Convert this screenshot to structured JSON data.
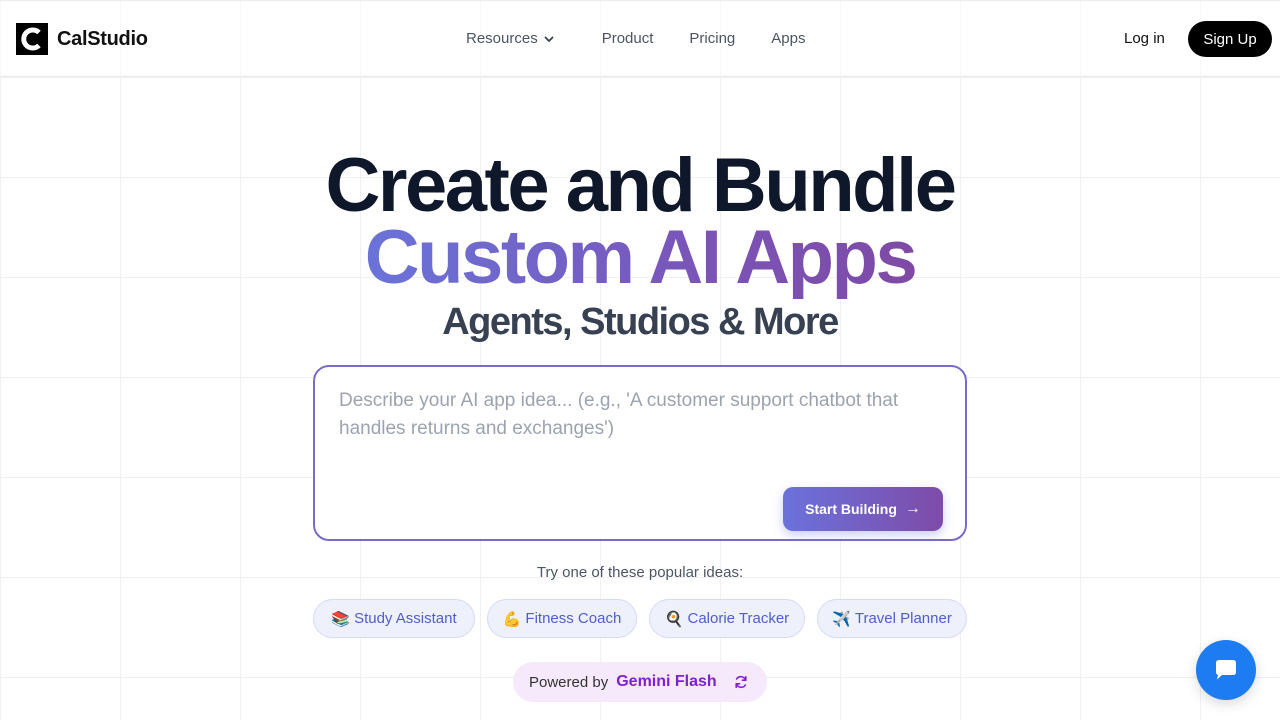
{
  "brand": {
    "name": "CalStudio"
  },
  "nav": {
    "resources": "Resources",
    "product": "Product",
    "pricing": "Pricing",
    "apps": "Apps"
  },
  "auth": {
    "login": "Log in",
    "signup": "Sign Up"
  },
  "hero": {
    "line1": "Create and Bundle",
    "line2": "Custom AI Apps",
    "line3": "Agents, Studios & More"
  },
  "prompt": {
    "placeholder": "Describe your AI app idea... (e.g., 'A customer support chatbot that handles returns and exchanges')",
    "value": "",
    "button": "Start Building",
    "button_arrow": "→"
  },
  "ideas": {
    "label": "Try one of these popular ideas:",
    "items": [
      {
        "emoji": "📚",
        "label": "Study Assistant"
      },
      {
        "emoji": "💪",
        "label": "Fitness Coach"
      },
      {
        "emoji": "🍳",
        "label": "Calorie Tracker"
      },
      {
        "emoji": "✈️",
        "label": "Travel Planner"
      }
    ]
  },
  "powered": {
    "label": "Powered by",
    "model": "Gemini Flash",
    "icon": "refresh-icon"
  },
  "chat": {
    "icon": "chat-bubble-icon"
  },
  "colors": {
    "accent_start": "#6a73d9",
    "accent_end": "#7e4aa5",
    "chip_text": "#4f5fc7",
    "model_text": "#7e22ce",
    "chat_bg": "#1d7cf2"
  }
}
